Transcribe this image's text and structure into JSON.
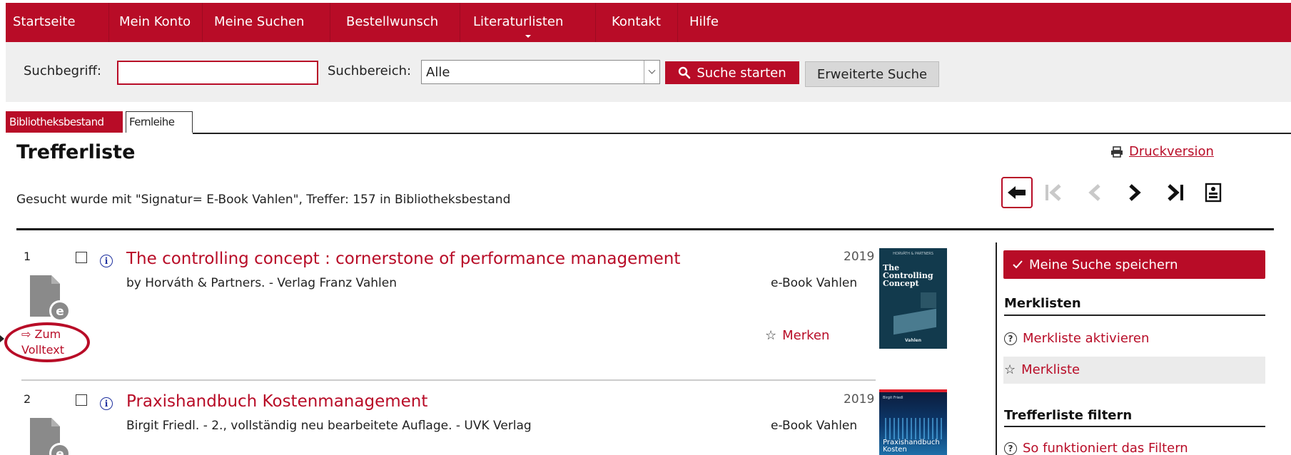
{
  "nav": {
    "items": [
      "Startseite",
      "Mein Konto",
      "Meine Suchen",
      "Bestellwunsch",
      "Literaturlisten",
      "Kontakt",
      "Hilfe"
    ],
    "active_marker_index": 4
  },
  "search": {
    "term_label": "Suchbegriff:",
    "term_value": "",
    "area_label": "Suchbereich:",
    "area_selected": "Alle",
    "submit_label": "Suche starten",
    "advanced_label": "Erweiterte Suche"
  },
  "tabs": {
    "active": "Bibliotheksbestand",
    "inactive": "Fernleihe"
  },
  "page": {
    "title": "Trefferliste",
    "print_label": "Druckversion",
    "query_text": "Gesucht wurde mit \"Signatur= E-Book Vahlen\", Treffer: 157 in Bibliotheksbestand"
  },
  "results": [
    {
      "number": "1",
      "title": "The controlling concept : cornerstone of performance management",
      "subtitle": "by Horváth & Partners. - Verlag Franz Vahlen",
      "year": "2019",
      "collection": "e-Book Vahlen",
      "fulltext_label_1": "⇨ Zum",
      "fulltext_label_2": "Volltext",
      "merken_label": "Merken",
      "cover": {
        "line1": "The Controlling",
        "line2": "Concept",
        "publisher": "Vahlen",
        "top": "HORVÁTH & PARTNERS"
      }
    },
    {
      "number": "2",
      "title": "Praxishandbuch Kostenmanagement",
      "subtitle": "Birgit Friedl. - 2., vollständig neu bearbeitete Auflage. - UVK Verlag",
      "year": "2019",
      "collection": "e-Book Vahlen",
      "cover": {
        "line1": "Praxishandbuch",
        "line2": "Kosten",
        "top": "Birgit Friedl"
      }
    }
  ],
  "sidebar": {
    "save_label": "Meine Suche speichern",
    "merklisten_heading": "Merklisten",
    "activate_label": "Merkliste aktivieren",
    "merkliste_label": "Merkliste",
    "filter_heading": "Trefferliste filtern",
    "filter_help_label": "So funktioniert das Filtern"
  },
  "colors": {
    "brand": "#b80c27",
    "link_blue": "#1d2f9e",
    "bar_bg": "#efefef"
  }
}
